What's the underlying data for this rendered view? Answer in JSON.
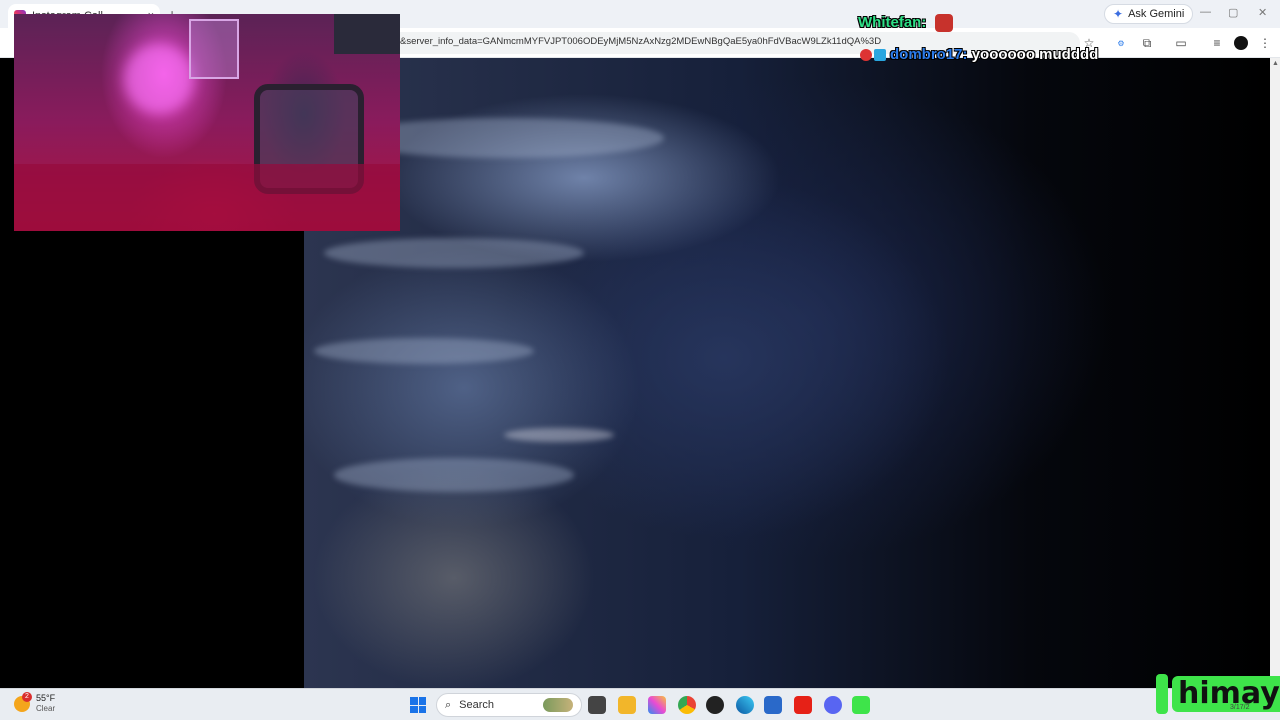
{
  "browser": {
    "tab_title": "Instagram Call",
    "tab_close": "×",
    "new_tab": "+",
    "url": "&server_info_data=GANmcmMYFVJPT006ODEyMjM5NzAxNzg2MDEwNBgQaE5ya0hFdVBacW9LZk11dQA%3D",
    "ask_gemini": "Ask Gemini",
    "icons": [
      "star-icon",
      "extensions-icon",
      "cast-icon",
      "menu-icon"
    ]
  },
  "chat": [
    {
      "user": "Whitefan:",
      "message": "",
      "color": "#2ee087"
    },
    {
      "user": "dombro17:",
      "message": "yoooooo mudddd",
      "color": "#2a7bea"
    }
  ],
  "taskbar": {
    "temperature": "55°F",
    "condition": "Clear",
    "weather_alert": "2",
    "search_label": "Search",
    "apps": [
      "file-explorer-icon",
      "folder-icon",
      "copilot-icon",
      "chrome-icon",
      "obs-icon",
      "edge-icon",
      "store-icon",
      "youtube-icon",
      "discord-icon",
      "kick-icon"
    ]
  },
  "overlay": {
    "brand": "himay",
    "date": "3/17/2"
  },
  "colors": {
    "accent_green": "#3ee44a",
    "taskbar_bg": "#e9edf2"
  }
}
